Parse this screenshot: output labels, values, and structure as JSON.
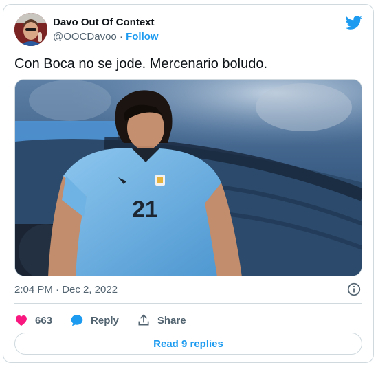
{
  "user": {
    "display_name": "Davo Out Of Context",
    "handle": "@OOCDavoo",
    "separator": " · ",
    "follow_label": "Follow"
  },
  "tweet": {
    "text": "Con Boca no se jode. Mercenario boludo.",
    "jersey_number": "21",
    "timestamp": "2:04 PM · Dec 2, 2022"
  },
  "actions": {
    "likes": "663",
    "reply_label": "Reply",
    "share_label": "Share"
  },
  "footer": {
    "read_replies_label": "Read 9 replies"
  },
  "colors": {
    "accent": "#1d9bf0",
    "like": "#f91880",
    "muted": "#536471",
    "border": "#cfd9de"
  }
}
